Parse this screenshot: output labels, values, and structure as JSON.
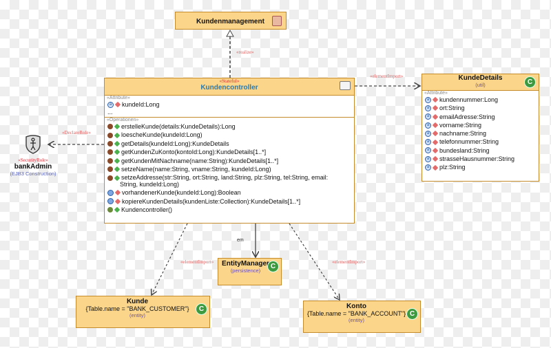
{
  "kundenmanagement": {
    "title": "Kundenmanagement",
    "icon": "interface-icon"
  },
  "controller": {
    "stereotype": "«Stateful»",
    "title": "Kundencontroller",
    "attr_section": "«Attribute»",
    "attributes": [
      "kundeId:Long",
      "..."
    ],
    "ops_section": "«Operationen»",
    "operations": [
      "erstelleKunde(details:KundeDetails):Long",
      "loescheKunde(kundeId:Long)",
      "getDetails(kundeId:Long):KundeDetails",
      "getKundenZuKonto(kontoId:Long):KundeDetails[1..*]",
      "getKundenMitNachname(name:String):KundeDetails[1..*]",
      "setzeName(name:String, vname:String, kundeId:Long)",
      "setzeAddresse(str:String, ort:String, land:String, plz:String, tel:String, email:",
      "String, kundeId:Long)",
      "vorhandenerKunde(kundeId:Long):Boolean",
      "kopiereKundenDetails(kundenListe:Collection):KundeDetails[1..*]",
      "Kundencontroller()"
    ]
  },
  "details": {
    "title": "KundeDetails",
    "package": "(util)",
    "attr_section": "«Attribute»",
    "attributes": [
      "kundennummer:Long",
      "ort:String",
      "emailAdresse:String",
      "vorname:String",
      "nachname:String",
      "telefonnummer:String",
      "bundesland:String",
      "strasseHausnummer:String",
      "plz:String"
    ]
  },
  "role": {
    "stereotype": "«SecurityRole»",
    "name": "bankAdmin",
    "sub": "(EJB3 Construction)"
  },
  "entity_manager": {
    "title": "EntityManager",
    "package": "(persistence)"
  },
  "kunde": {
    "title": "Kunde",
    "table": "{Table.name = \"BANK_CUSTOMER\"}",
    "package": "(entity)"
  },
  "konto": {
    "title": "Konto",
    "table": "{Table.name = \"BANK_ACCOUNT\"}",
    "package": "(entity)"
  },
  "labels": {
    "realize": "«realize»",
    "import1": "«elementImport»",
    "declare": "«DeclareRole»",
    "em": "em",
    "import2": "«elementImport»",
    "import3": "«elementImport»"
  },
  "class_icon": "C"
}
